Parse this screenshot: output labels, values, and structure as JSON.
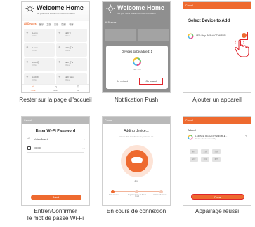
{
  "screen1": {
    "title": "Welcome Home",
    "subtitle": "Set your home location for more information",
    "tabs": [
      "All Devices",
      "客厅",
      "主卧",
      "次卧",
      "厨房",
      "书房"
    ],
    "devices": [
      {
        "name": "Lamp",
        "status": "Offline"
      },
      {
        "name": "LED 灯",
        "status": "Offline"
      },
      {
        "name": "Lamp",
        "status": "Offline"
      },
      {
        "name": "LED 灯 2",
        "status": "Offline"
      },
      {
        "name": "LED 灯",
        "status": "Offline"
      },
      {
        "name": "LED 灯 3",
        "status": "Offline"
      },
      {
        "name": "LED 灯",
        "status": "Offline"
      },
      {
        "name": "LED Strip",
        "status": "Offline"
      }
    ],
    "nav": {
      "home": "Home",
      "smart": "Smart",
      "me": "Me"
    }
  },
  "screen2": {
    "title": "Welcome Home",
    "subtitle": "Set your home location for more information",
    "tab": "All Devices",
    "dialog_title": "Devices to be added: 1",
    "device_label": "LED Strip",
    "do_not_add": "Do not add",
    "go_to_add": "Go to add"
  },
  "screen3": {
    "header": "Cancel",
    "title": "Select Device to Add",
    "device": "LED Strip RGB+CCT WiFi-BL..."
  },
  "screen4": {
    "header": "Cancel",
    "title": "Enter Wi-Fi Password",
    "ssid": "UnicoSmart",
    "password": "••••••••",
    "next": "Next"
  },
  "screen5": {
    "header": "Cancel",
    "title": "Adding device...",
    "hint": "Ensure that the device is powered on.",
    "percent": "8%",
    "steps": [
      "Scan devices",
      "Register device on Smart Cloud",
      "Initialize the device"
    ]
  },
  "screen6": {
    "header": "Cancel",
    "added_label": "Added",
    "device": "LED Strip RGB+CCT WiFi-BLE...",
    "device_status": "Device added successfully",
    "rooms": [
      "客厅",
      "主卧",
      "次卧",
      "厨房",
      "书房",
      "餐厅"
    ],
    "done": "Done"
  },
  "captions": {
    "c1": "Rester sur la page d\"accueil",
    "c2": "Notification Push",
    "c3": "Ajouter un appareil",
    "c4_line1": "Entrer/Confirmer",
    "c4_line2": "le mot de passe Wi-Fi",
    "c5": "En cours de connexion",
    "c6": "Appairage réussi"
  },
  "colors": {
    "accent": "#ee6a2f",
    "highlight": "#e0262d"
  }
}
